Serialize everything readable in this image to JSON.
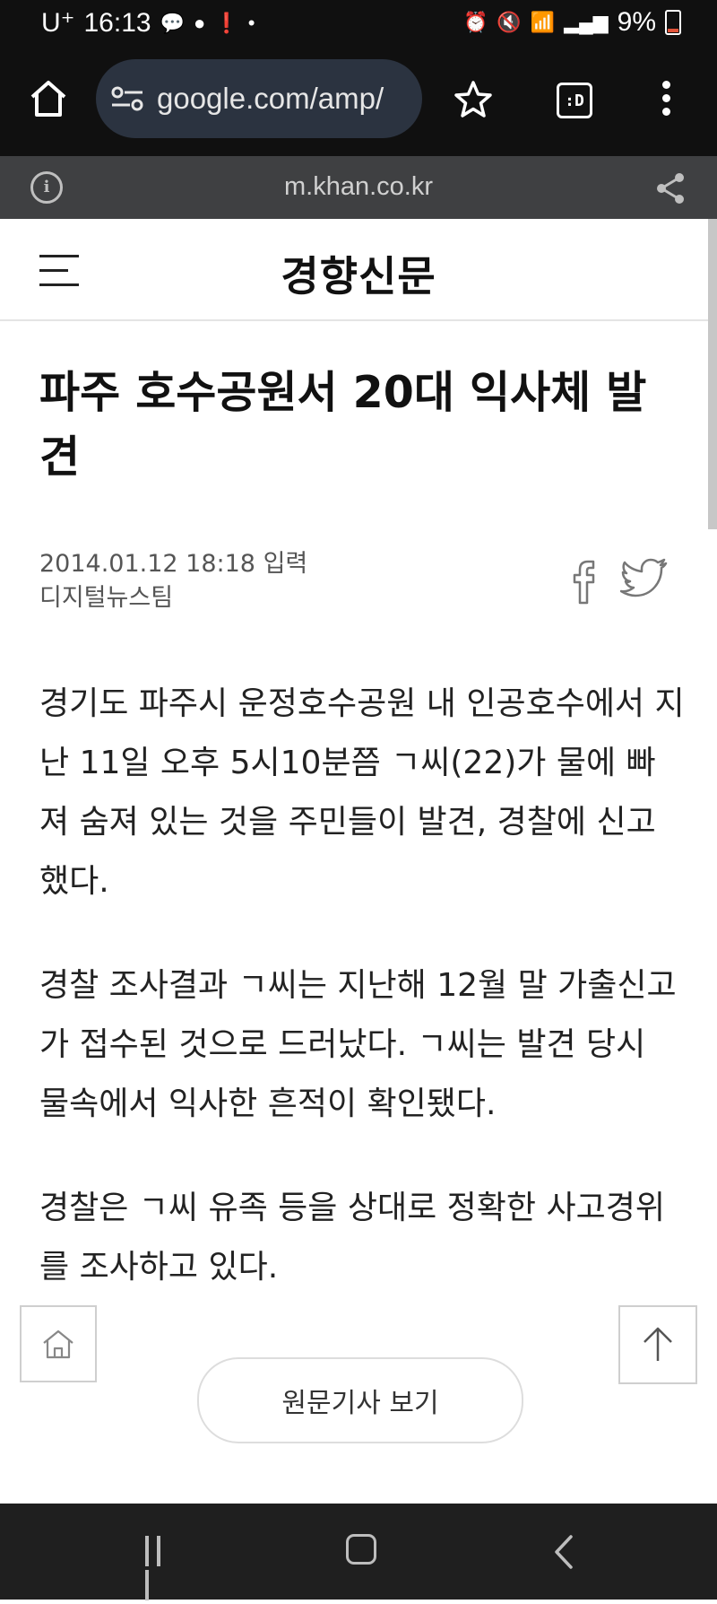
{
  "status_bar": {
    "carrier": "U⁺",
    "time": "16:13",
    "battery": "9%",
    "icons": [
      "talk-icon",
      "chat-icon",
      "alert-icon",
      "dot-icon",
      "alarm-icon",
      "mute-icon",
      "wifi-icon",
      "signal-icon",
      "battery-icon"
    ]
  },
  "browser": {
    "url": "google.com/amp/",
    "tabs_label": ":D"
  },
  "site_bar": {
    "domain": "m.khan.co.kr"
  },
  "header": {
    "logo": "경향신문"
  },
  "article": {
    "headline": "파주 호수공원서 20대 익사체 발견",
    "date": "2014.01.12 18:18 입력",
    "author": "디지털뉴스팀",
    "paragraphs": [
      "경기도 파주시 운정호수공원 내 인공호수에서 지난 11일 오후 5시10분쯤 ㄱ씨(22)가 물에 빠져 숨져 있는 것을 주민들이 발견, 경찰에 신고했다.",
      "경찰 조사결과 ㄱ씨는 지난해 12월 말 가출신고가 접수된 것으로 드러났다. ㄱ씨는 발견 당시 물속에서 익사한 흔적이 확인됐다.",
      "경찰은 ㄱ씨 유족 등을 상대로 정확한 사고경위를 조사하고 있다."
    ]
  },
  "buttons": {
    "original_article": "원문기사 보기"
  }
}
